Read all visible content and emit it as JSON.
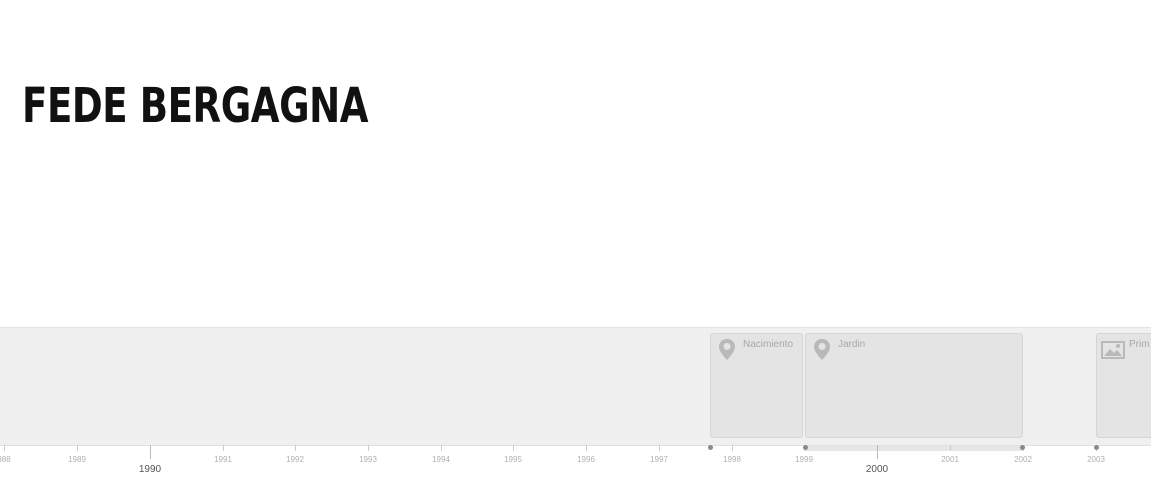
{
  "page": {
    "title": "FEDE BERGAGNA"
  },
  "timeline": {
    "events": [
      {
        "label": "Nacimiento",
        "icon": "map-pin-icon"
      },
      {
        "label": "Jardin",
        "icon": "map-pin-icon"
      },
      {
        "label": "Prim",
        "icon": "image-icon"
      }
    ],
    "minor_years": [
      "988",
      "1989",
      "1991",
      "1992",
      "1993",
      "1994",
      "1995",
      "1996",
      "1997",
      "1998",
      "1999",
      "2001",
      "2002",
      "2003"
    ],
    "major_years": [
      "1990",
      "2000"
    ]
  },
  "colors": {
    "background": "#ffffff",
    "timeline_background": "#f0f0f0",
    "event_card": "#e4e4e4",
    "marker": "#8a8a8a"
  }
}
